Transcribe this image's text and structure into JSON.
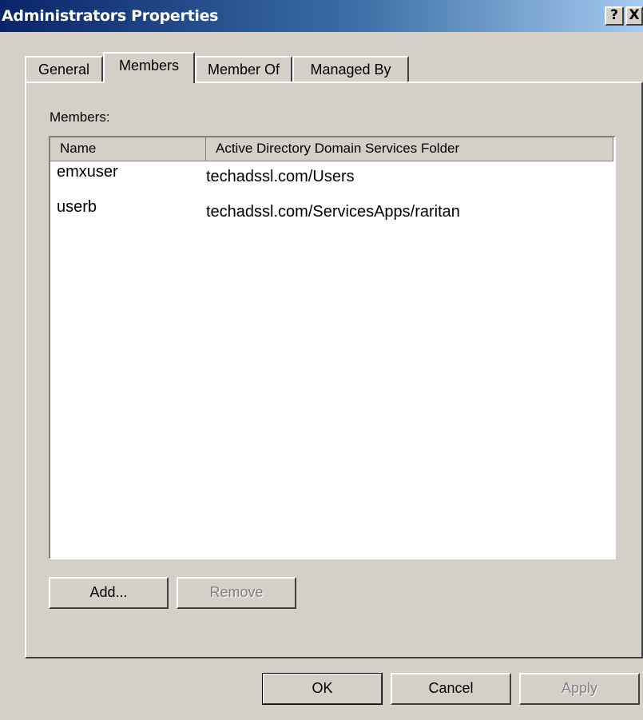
{
  "window": {
    "title": "Administrators Properties",
    "help_label": "?",
    "close_label": "X"
  },
  "tabs": [
    {
      "label": "General",
      "selected": false
    },
    {
      "label": "Members",
      "selected": true
    },
    {
      "label": "Member Of",
      "selected": false
    },
    {
      "label": "Managed By",
      "selected": false
    }
  ],
  "members": {
    "label": "Members:",
    "columns": [
      "Name",
      "Active Directory Domain Services Folder"
    ],
    "rows": [
      {
        "name": "emxuser",
        "folder": "techadssl.com/Users"
      },
      {
        "name": "userb",
        "folder": "techadssl.com/ServicesApps/raritan"
      }
    ],
    "add_label": "Add...",
    "remove_label": "Remove"
  },
  "footer": {
    "ok_label": "OK",
    "cancel_label": "Cancel",
    "apply_label": "Apply"
  },
  "colors": {
    "dialog_bg": "#d4d0c8",
    "titlebar_start": "#0a246a",
    "titlebar_end": "#a6caf0",
    "disabled_text": "#808080"
  }
}
